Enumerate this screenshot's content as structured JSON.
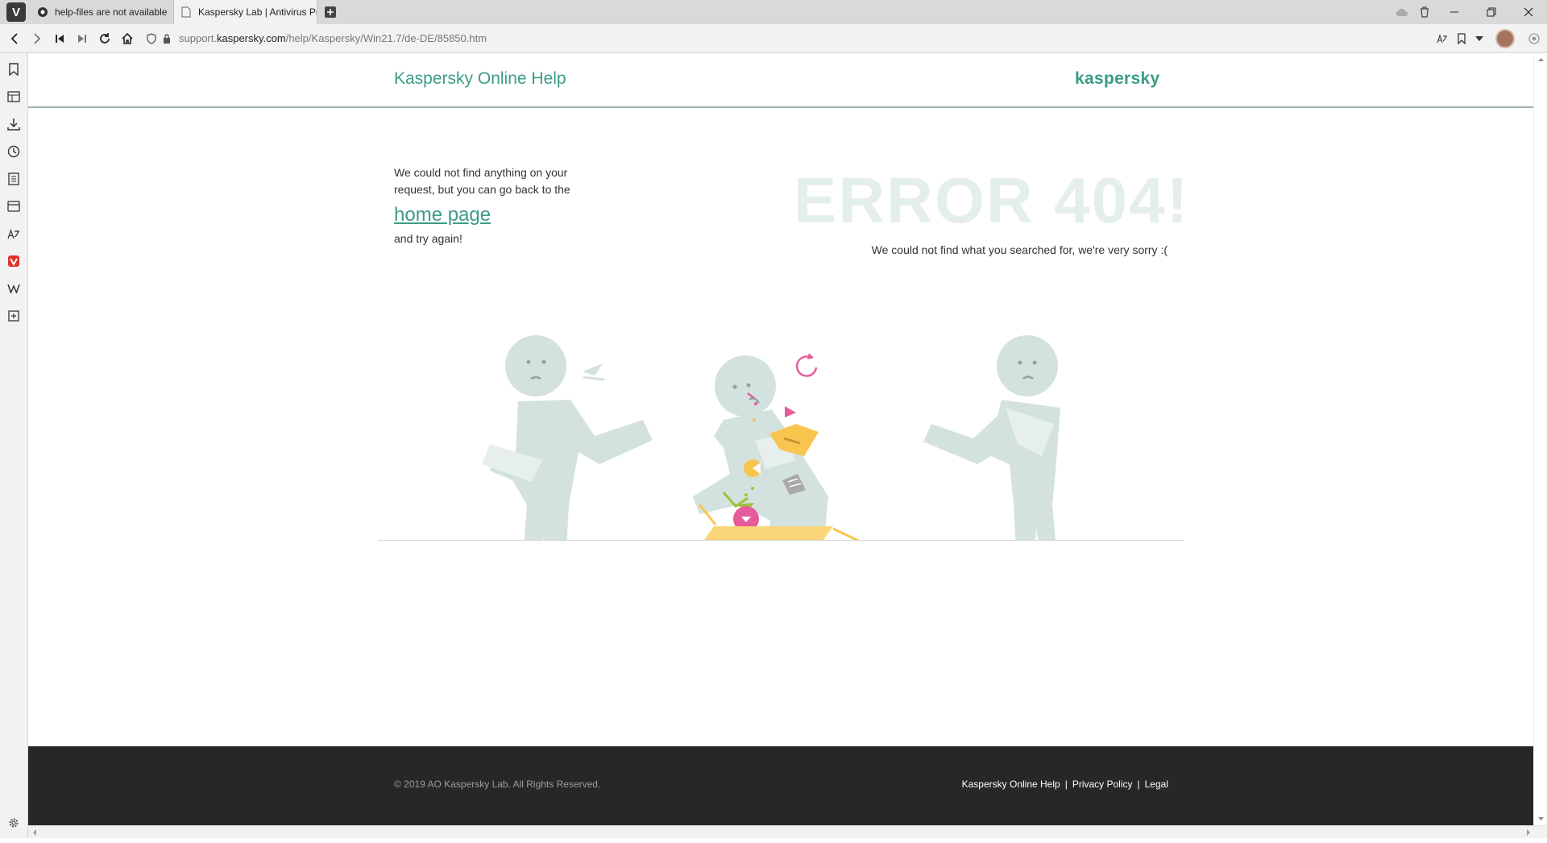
{
  "browser": {
    "tabs": [
      {
        "title": "help-files are not available",
        "active": false
      },
      {
        "title": "Kaspersky Lab | Antivirus Pr",
        "active": true
      }
    ],
    "url_domain_prefix": "support.",
    "url_domain": "kaspersky.com",
    "url_path": "/help/Kaspersky/Win21.7/de-DE/85850.htm"
  },
  "header": {
    "site_title": "Kaspersky Online Help",
    "brand": "kaspersky"
  },
  "message": {
    "line1": "We could not find anything on your request, but you can go back to the",
    "link": "home page",
    "line2": "and try again!"
  },
  "error": {
    "title": "ERROR 404!",
    "subtitle": "We could not find what you searched for, we're very sorry :("
  },
  "footer": {
    "copyright": "© 2019 AO Kaspersky Lab. All Rights Reserved.",
    "links": [
      "Kaspersky Online Help",
      "Privacy Policy",
      "Legal"
    ],
    "separator": "|"
  },
  "colors": {
    "accent": "#3b9c86",
    "footer_bg": "#272727",
    "figure": "#d3e2df",
    "box": "#f9c54f"
  }
}
